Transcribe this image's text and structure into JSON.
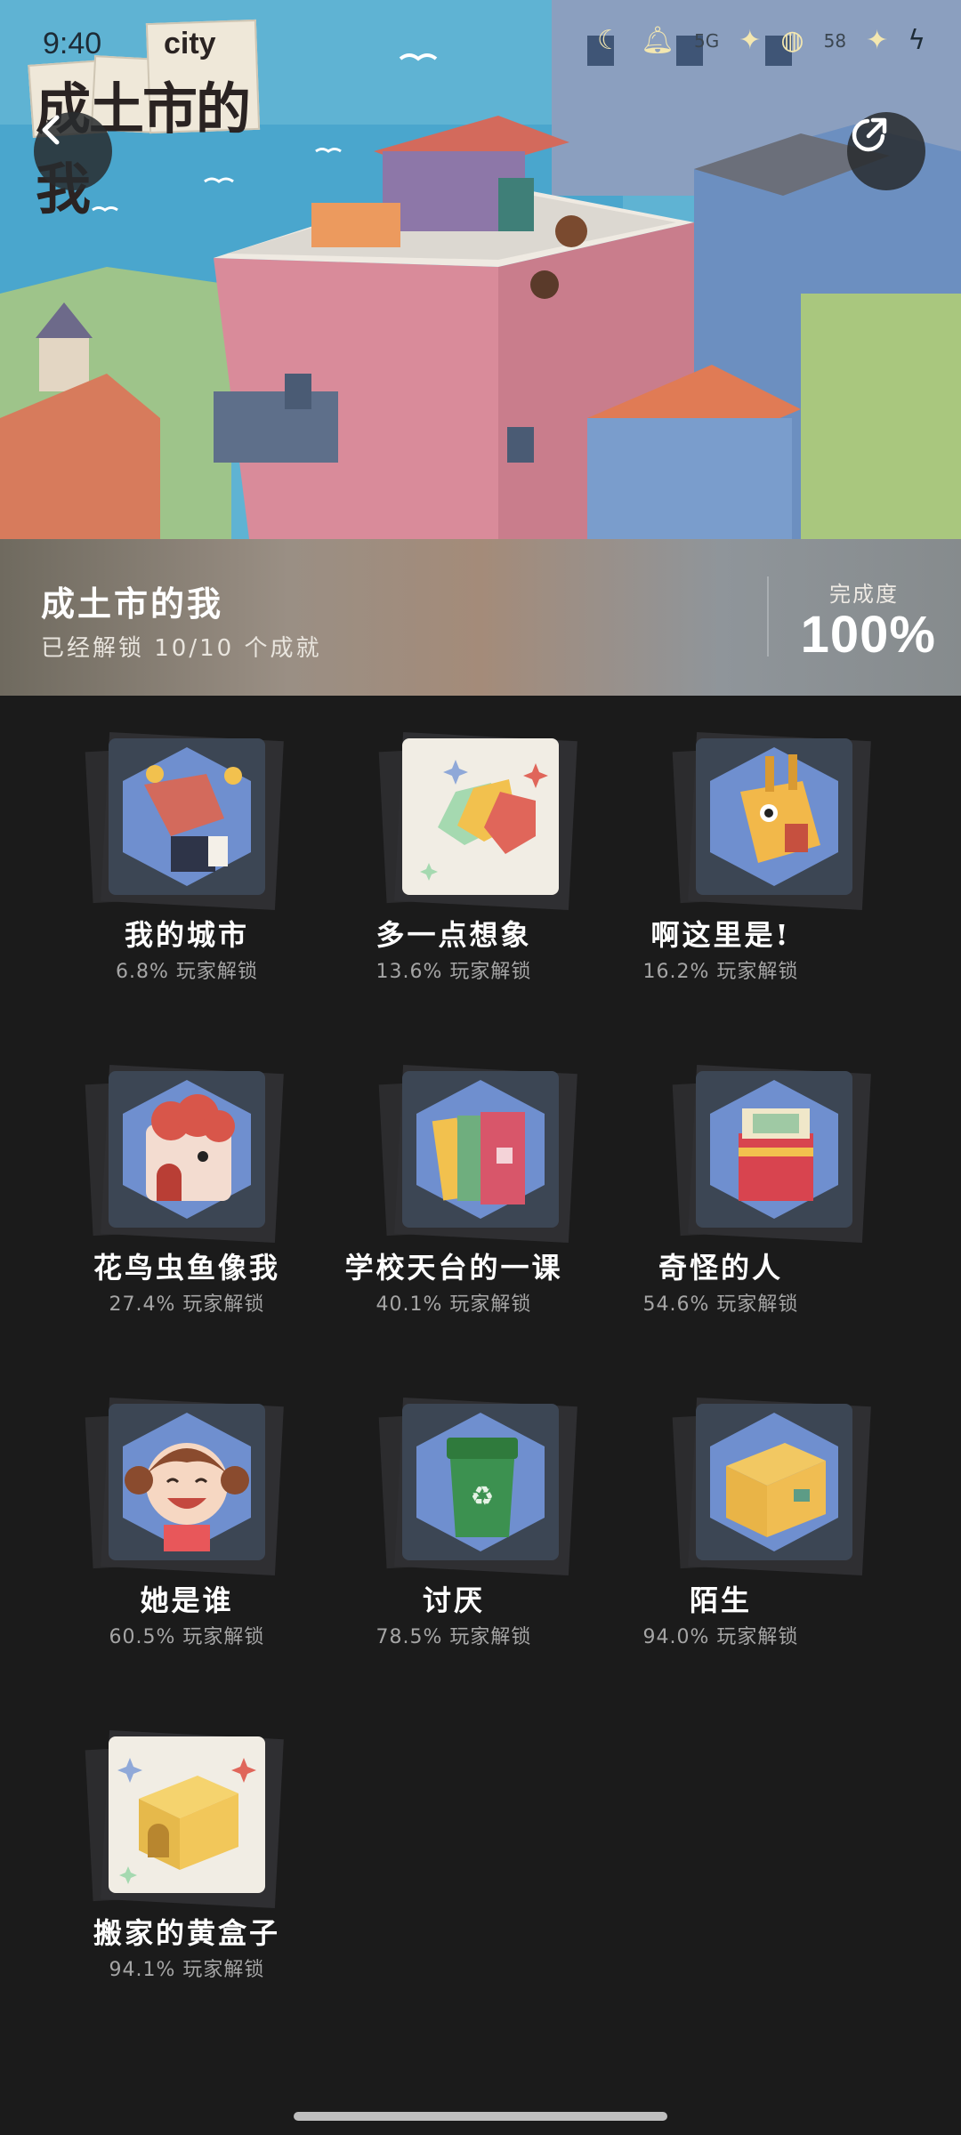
{
  "status_bar": {
    "time": "9:40",
    "network": "5G",
    "battery": "58"
  },
  "logo": {
    "title": "成土市的我",
    "city": "city"
  },
  "header": {
    "back_icon": "chevron-left-icon",
    "share_icon": "share-icon"
  },
  "game": {
    "title": "成土市的我",
    "subtitle": "已经解锁 10/10 个成就",
    "completion_label": "完成度",
    "completion_value": "100%"
  },
  "achievements": [
    {
      "name": "我的城市",
      "rate": "6.8% 玩家解锁"
    },
    {
      "name": "多一点想象",
      "rate": "13.6% 玩家解锁"
    },
    {
      "name": "啊这里是!",
      "rate": "16.2% 玩家解锁"
    },
    {
      "name": "花鸟虫鱼像我",
      "rate": "27.4% 玩家解锁"
    },
    {
      "name": "学校天台的一课",
      "rate": "40.1% 玩家解锁"
    },
    {
      "name": "奇怪的人",
      "rate": "54.6% 玩家解锁"
    },
    {
      "name": "她是谁",
      "rate": "60.5% 玩家解锁"
    },
    {
      "name": "讨厌",
      "rate": "78.5% 玩家解锁"
    },
    {
      "name": "陌生",
      "rate": "94.0% 玩家解锁"
    },
    {
      "name": "搬家的黄盒子",
      "rate": "94.1% 玩家解锁"
    }
  ],
  "colors": {
    "background": "#1b1b1b",
    "badge_blue": "#6f8fcf",
    "badge_frame": "#3c4654"
  }
}
